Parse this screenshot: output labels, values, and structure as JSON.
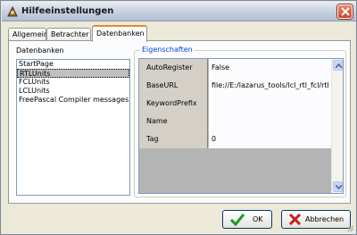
{
  "window": {
    "title": "Hilfeeinstellungen"
  },
  "tabs": [
    {
      "label": "Allgemein",
      "active": false
    },
    {
      "label": "Betrachter",
      "active": false
    },
    {
      "label": "Datenbanken",
      "active": true
    }
  ],
  "databases": {
    "label": "Datenbanken",
    "items": [
      "StartPage",
      "RTLUnits",
      "FCLUnits",
      "LCLUnits",
      "FreePascal Compiler messages"
    ],
    "selected": "RTLUnits"
  },
  "properties": {
    "caption": "Eigenschaften",
    "rows": [
      {
        "name": "AutoRegister",
        "value": "False"
      },
      {
        "name": "BaseURL",
        "value": "file://E:/lazarus_tools/lcl_rtl_fcl/rtl"
      },
      {
        "name": "KeywordPrefix",
        "value": ""
      },
      {
        "name": "Name",
        "value": ""
      },
      {
        "name": "Tag",
        "value": "0"
      }
    ]
  },
  "buttons": {
    "ok": "OK",
    "cancel": "Abbrechen"
  }
}
